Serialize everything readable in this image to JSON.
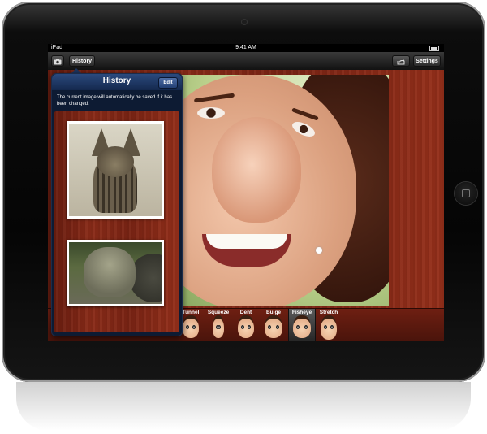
{
  "status_bar": {
    "carrier": "iPad",
    "time": "9:41 AM"
  },
  "toolbar": {
    "camera_icon": "camera-icon",
    "history_label": "History",
    "share_icon": "share-icon",
    "settings_label": "Settings"
  },
  "history_popover": {
    "title": "History",
    "edit_label": "Edit",
    "message": "The current image will automatically be saved if it has been changed.",
    "items": [
      {
        "subject": "cat"
      },
      {
        "subject": "turtle"
      }
    ]
  },
  "effects": [
    {
      "label": "Tunnel",
      "selected": false
    },
    {
      "label": "Squeeze",
      "selected": false
    },
    {
      "label": "Dent",
      "selected": false
    },
    {
      "label": "Bulge",
      "selected": false
    },
    {
      "label": "Fisheye",
      "selected": true
    },
    {
      "label": "Stretch",
      "selected": false
    }
  ]
}
